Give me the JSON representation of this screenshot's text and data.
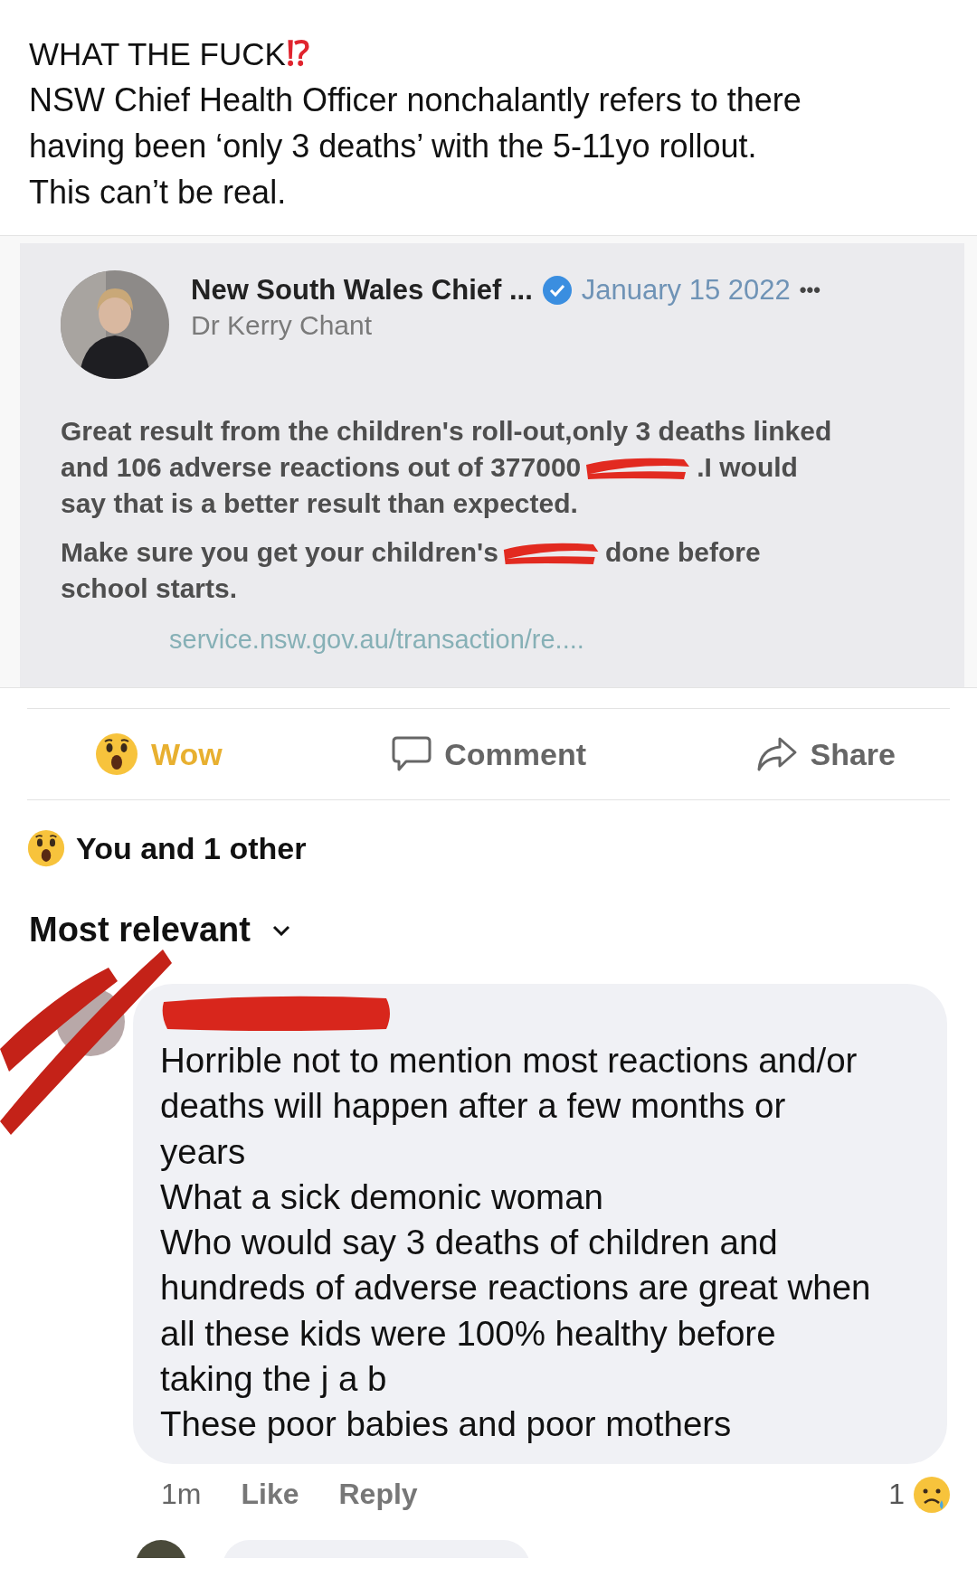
{
  "post": {
    "caption_title": "WHAT THE FUCK",
    "caption_emoji": "⁉",
    "caption_lines": [
      "NSW Chief Health Officer nonchalantly refers to there",
      "having been ‘only 3 deaths’ with the 5-11yo rollout.",
      "This can’t be real."
    ]
  },
  "shared_image": {
    "page_name": "New South Wales Chief ...",
    "verified": true,
    "date": "January 15 2022",
    "more": "•••",
    "author": "Dr Kerry Chant",
    "paragraphs": [
      {
        "lines": [
          {
            "parts": [
              "Great result from the children's roll-out,only 3 deaths linked"
            ]
          },
          {
            "parts": [
              "and 106 adverse reactions out of 377000",
              ".I would"
            ]
          },
          {
            "parts": [
              "say that is a better result than expected."
            ]
          }
        ]
      },
      {
        "lines": [
          {
            "parts": [
              "Make sure you get your children's",
              "done before"
            ]
          },
          {
            "parts": [
              "school starts."
            ]
          }
        ]
      }
    ],
    "link": "service.nsw.gov.au/transaction/re...."
  },
  "actions": [
    {
      "label": "Wow",
      "kind": "wow",
      "selected": true
    },
    {
      "label": "Comment",
      "kind": "comment",
      "selected": false
    },
    {
      "label": "Share",
      "kind": "share",
      "selected": false
    }
  ],
  "reactions_summary": "You and 1 other",
  "sort": {
    "label": "Most relevant"
  },
  "comments": [
    {
      "lines": [
        "Horrible not to mention most reactions and/or",
        "deaths will happen after a few months or",
        "years",
        "What a sick demonic woman",
        "Who would say 3 deaths of children and",
        "hundreds of adverse reactions are great when",
        "all these kids were 100% healthy before",
        "taking the j a b",
        "These poor babies and poor mothers"
      ],
      "time": "1m",
      "like": "Like",
      "reply": "Reply",
      "reaction_count": "1"
    }
  ]
}
